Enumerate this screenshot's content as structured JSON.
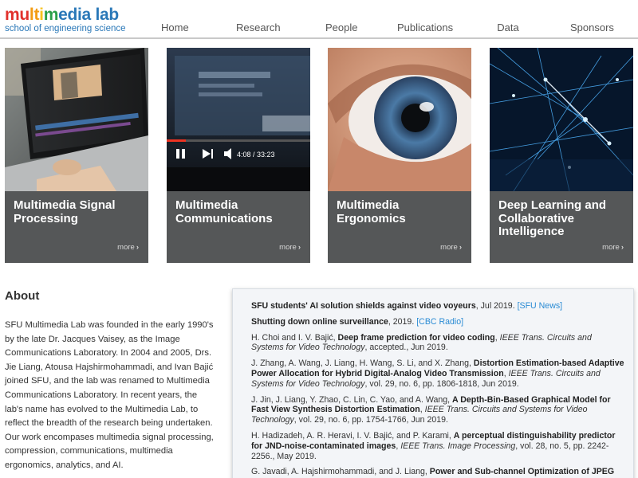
{
  "logo": {
    "letters": [
      {
        "ch": "m",
        "color": "#e1312c"
      },
      {
        "ch": "u",
        "color": "#e1312c"
      },
      {
        "ch": "l",
        "color": "#f39c12"
      },
      {
        "ch": "t",
        "color": "#f39c12"
      },
      {
        "ch": "i",
        "color": "#f7c21d"
      },
      {
        "ch": "m",
        "color": "#2a9f48"
      },
      {
        "ch": "e",
        "color": "#2a78b8"
      },
      {
        "ch": "d",
        "color": "#2a78b8"
      },
      {
        "ch": "i",
        "color": "#2a78b8"
      },
      {
        "ch": "a",
        "color": "#2a78b8"
      },
      {
        "ch": " ",
        "color": "#2a78b8"
      },
      {
        "ch": "l",
        "color": "#2a78b8"
      },
      {
        "ch": "a",
        "color": "#2a78b8"
      },
      {
        "ch": "b",
        "color": "#2a78b8"
      }
    ],
    "tagline": "school of engineering science"
  },
  "nav": {
    "home": "Home",
    "research": "Research",
    "people": "People",
    "publications": "Publications",
    "data": "Data",
    "sponsors": "Sponsors"
  },
  "cards": [
    {
      "title": "Multimedia Signal Processing",
      "more": "more"
    },
    {
      "title": "Multimedia Communications",
      "more": "more"
    },
    {
      "title": "Multimedia Ergonomics",
      "more": "more"
    },
    {
      "title": "Deep Learning and Collaborative Intelligence",
      "more": "more"
    }
  ],
  "video_overlay": {
    "time": "4:08 / 33:23"
  },
  "about": {
    "title": "About",
    "text": "SFU Multimedia Lab was founded in the early 1990's by the late Dr. Jacques Vaisey, as the Image Communications Laboratory. In 2004 and 2005, Drs. Jie Liang, Atousa Hajshirmohammadi, and Ivan Bajić joined SFU, and the lab was renamed to Multimedia Communications Laboratory. In recent years, the lab's name has evolved to the Multimedia Lab, to reflect the breadth of the research being undertaken. Our work encompases multimedia signal processing, compression, communications, multimedia ergonomics, analytics, and AI."
  },
  "news": [
    {
      "headline": "SFU students' AI solution shields against video voyeurs",
      "rest": ", Jul 2019. ",
      "link": "[SFU News]"
    },
    {
      "headline": "Shutting down online surveillance",
      "rest": ", 2019. ",
      "link": "[CBC Radio]"
    },
    {
      "authors": "H. Choi and I. V. Bajić, ",
      "title": "Deep frame prediction for video coding",
      "sep": ", ",
      "venue": "IEEE Trans. Circuits and Systems for Video Technology",
      "details": ", accepted., Jun 2019."
    },
    {
      "authors": "J. Zhang, A. Wang, J. Liang, H. Wang, S. Li, and X. Zhang, ",
      "title": "Distortion Estimation-based Adaptive Power Allocation for Hybrid Digital-Analog Video Transmission",
      "sep": ", ",
      "venue": "IEEE Trans. Circuits and Systems for Video Technology",
      "details": ", vol. 29, no. 6, pp. 1806-1818, Jun 2019."
    },
    {
      "authors": "J. Jin, J. Liang, Y. Zhao, C. Lin, C. Yao, and A. Wang, ",
      "title": "A Depth-Bin-Based Graphical Model for Fast View Synthesis Distortion Estimation",
      "sep": ", ",
      "venue": "IEEE Trans. Circuits and Systems for Video Technology",
      "details": ", vol. 29, no. 6, pp. 1754-1766, Jun 2019."
    },
    {
      "authors": "H. Hadizadeh, A. R. Heravi, I. V. Bajić, and P. Karami, ",
      "title": "A perceptual distinguishability predictor for JND-noise-contaminated images",
      "sep": ", ",
      "venue": "IEEE Trans. Image Processing",
      "details": ", vol. 28, no. 5, pp. 2242-2256., May 2019."
    },
    {
      "authors": "G. Javadi, A. Hajshirmohammadi, and J. Liang, ",
      "title": "Power and Sub-channel Optimization of JPEG",
      "sep": "",
      "venue": "",
      "details": ""
    }
  ]
}
